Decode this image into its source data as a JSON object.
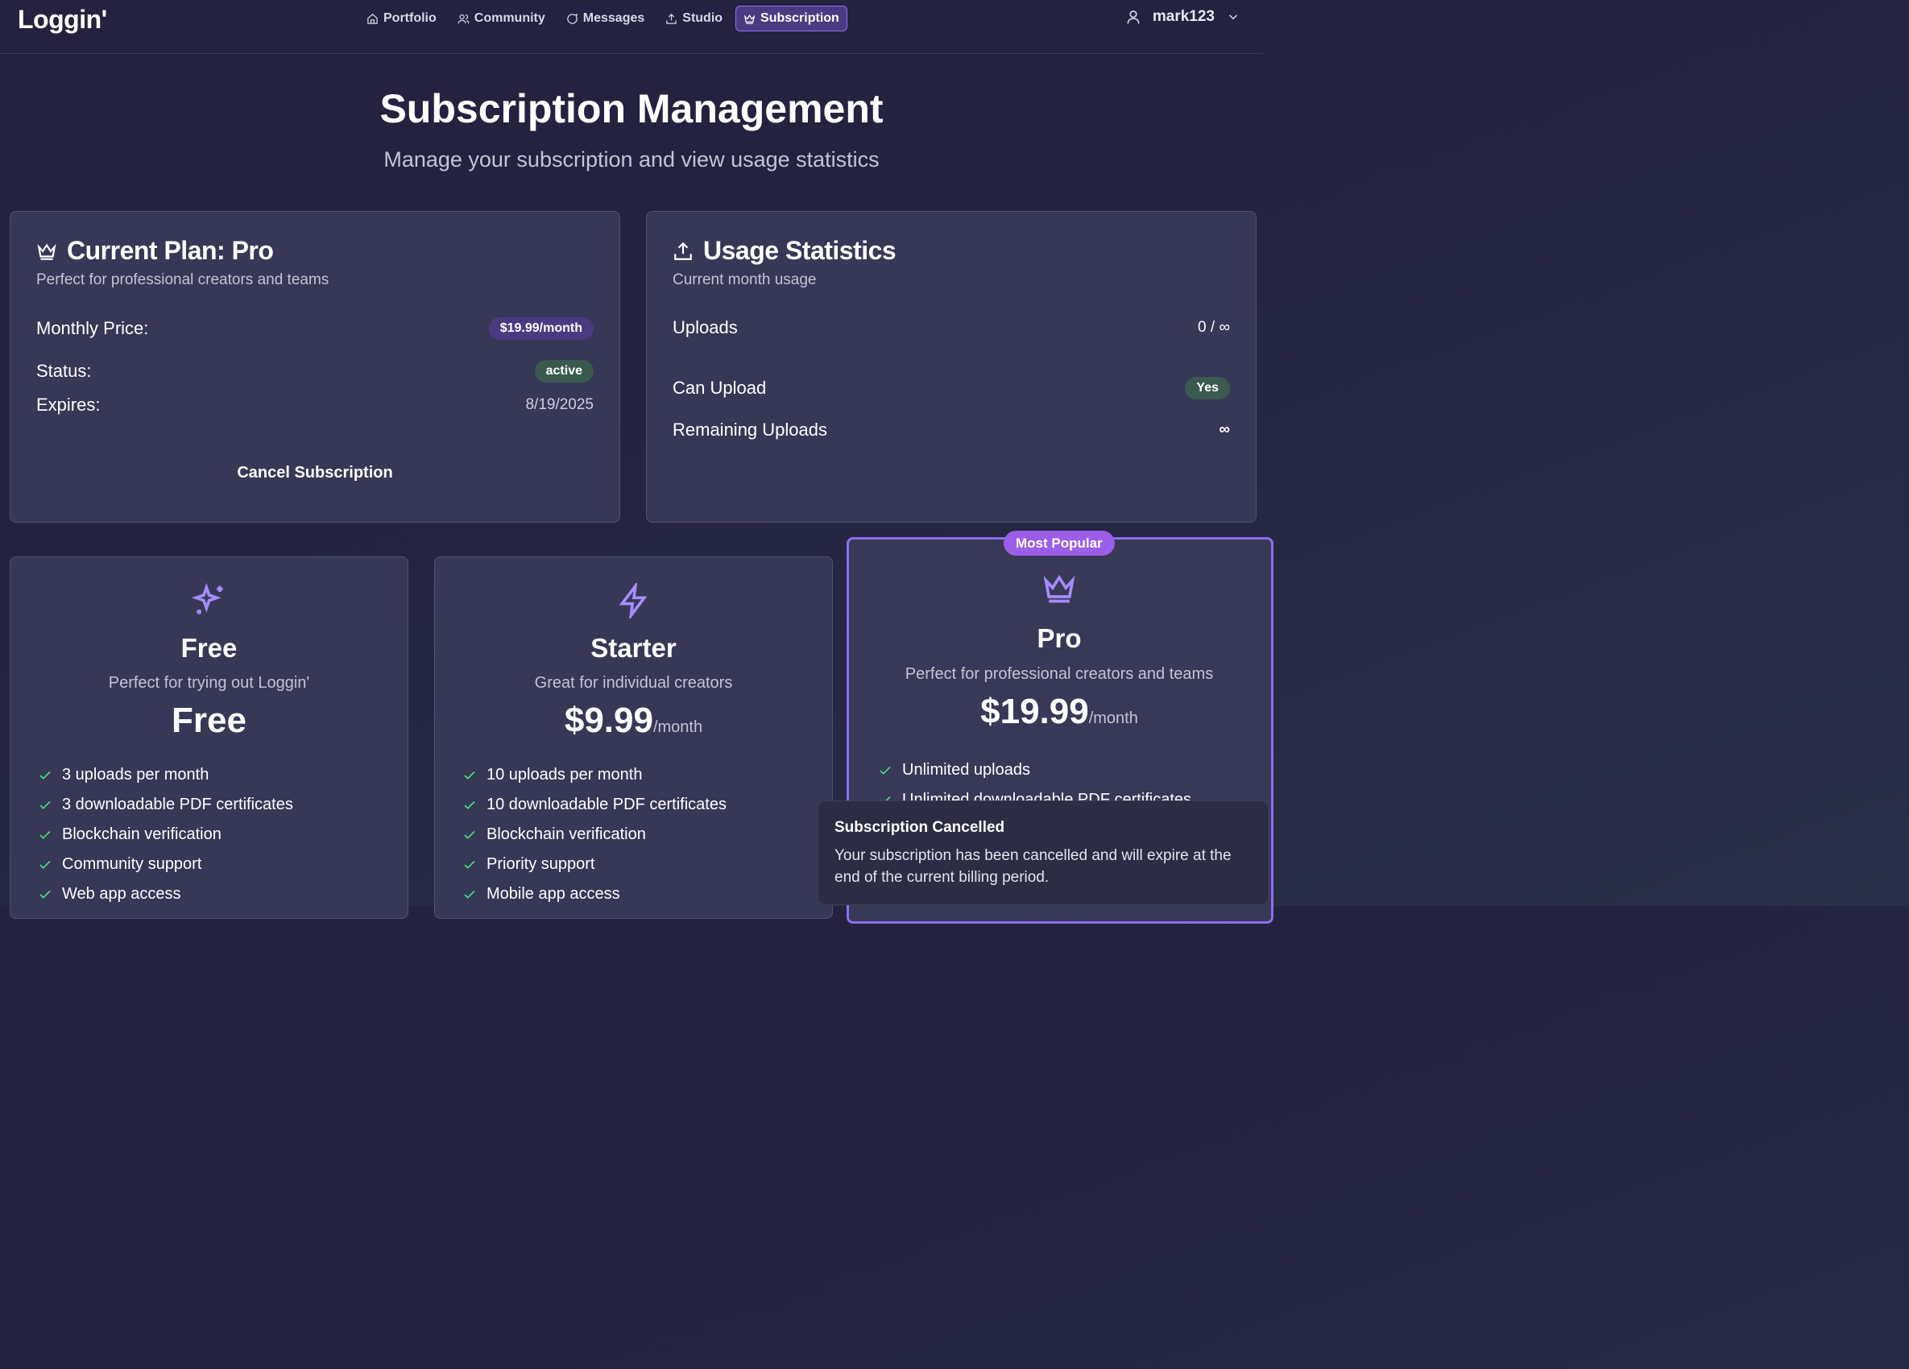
{
  "app": {
    "logo": "Loggin'"
  },
  "nav": {
    "items": [
      {
        "label": "Portfolio",
        "icon": "home-icon"
      },
      {
        "label": "Community",
        "icon": "users-icon"
      },
      {
        "label": "Messages",
        "icon": "message-icon"
      },
      {
        "label": "Studio",
        "icon": "upload-icon"
      },
      {
        "label": "Subscription",
        "icon": "crown-icon",
        "active": true
      }
    ],
    "user": {
      "name": "mark123"
    }
  },
  "header": {
    "title": "Subscription Management",
    "subtitle": "Manage your subscription and view usage statistics"
  },
  "current_plan": {
    "title": "Current Plan: Pro",
    "description": "Perfect for professional creators and teams",
    "monthly_price_label": "Monthly Price:",
    "monthly_price_value": "$19.99/month",
    "status_label": "Status:",
    "status_value": "active",
    "expires_label": "Expires:",
    "expires_value": "8/19/2025",
    "cancel_label": "Cancel Subscription"
  },
  "usage": {
    "title": "Usage Statistics",
    "description": "Current month usage",
    "uploads_label": "Uploads",
    "uploads_value": "0 / ∞",
    "can_upload_label": "Can Upload",
    "can_upload_value": "Yes",
    "remaining_label": "Remaining Uploads",
    "remaining_value": "∞"
  },
  "plans": [
    {
      "name": "Free",
      "description": "Perfect for trying out Loggin'",
      "price": "Free",
      "per": "",
      "icon": "sparkles-icon",
      "features": [
        "3 uploads per month",
        "3 downloadable PDF certificates",
        "Blockchain verification",
        "Community support",
        "Web app access"
      ]
    },
    {
      "name": "Starter",
      "description": "Great for individual creators",
      "price": "$9.99",
      "per": "/month",
      "icon": "lightning-icon",
      "features": [
        "10 uploads per month",
        "10 downloadable PDF certificates",
        "Blockchain verification",
        "Priority support",
        "Mobile app access"
      ]
    },
    {
      "name": "Pro",
      "description": "Perfect for professional creators and teams",
      "price": "$19.99",
      "per": "/month",
      "icon": "crown-icon",
      "badge": "Most Popular",
      "features": [
        "Unlimited uploads",
        "Unlimited downloadable PDF certificates"
      ]
    }
  ],
  "toast": {
    "title": "Subscription Cancelled",
    "body": "Your subscription has been cancelled and will expire at the end of the current billing period."
  },
  "colors": {
    "accent": "#8d6ef0",
    "badge_purple": "#9b5ee8",
    "check_green": "#4ade80",
    "card_bg": "#363856"
  }
}
